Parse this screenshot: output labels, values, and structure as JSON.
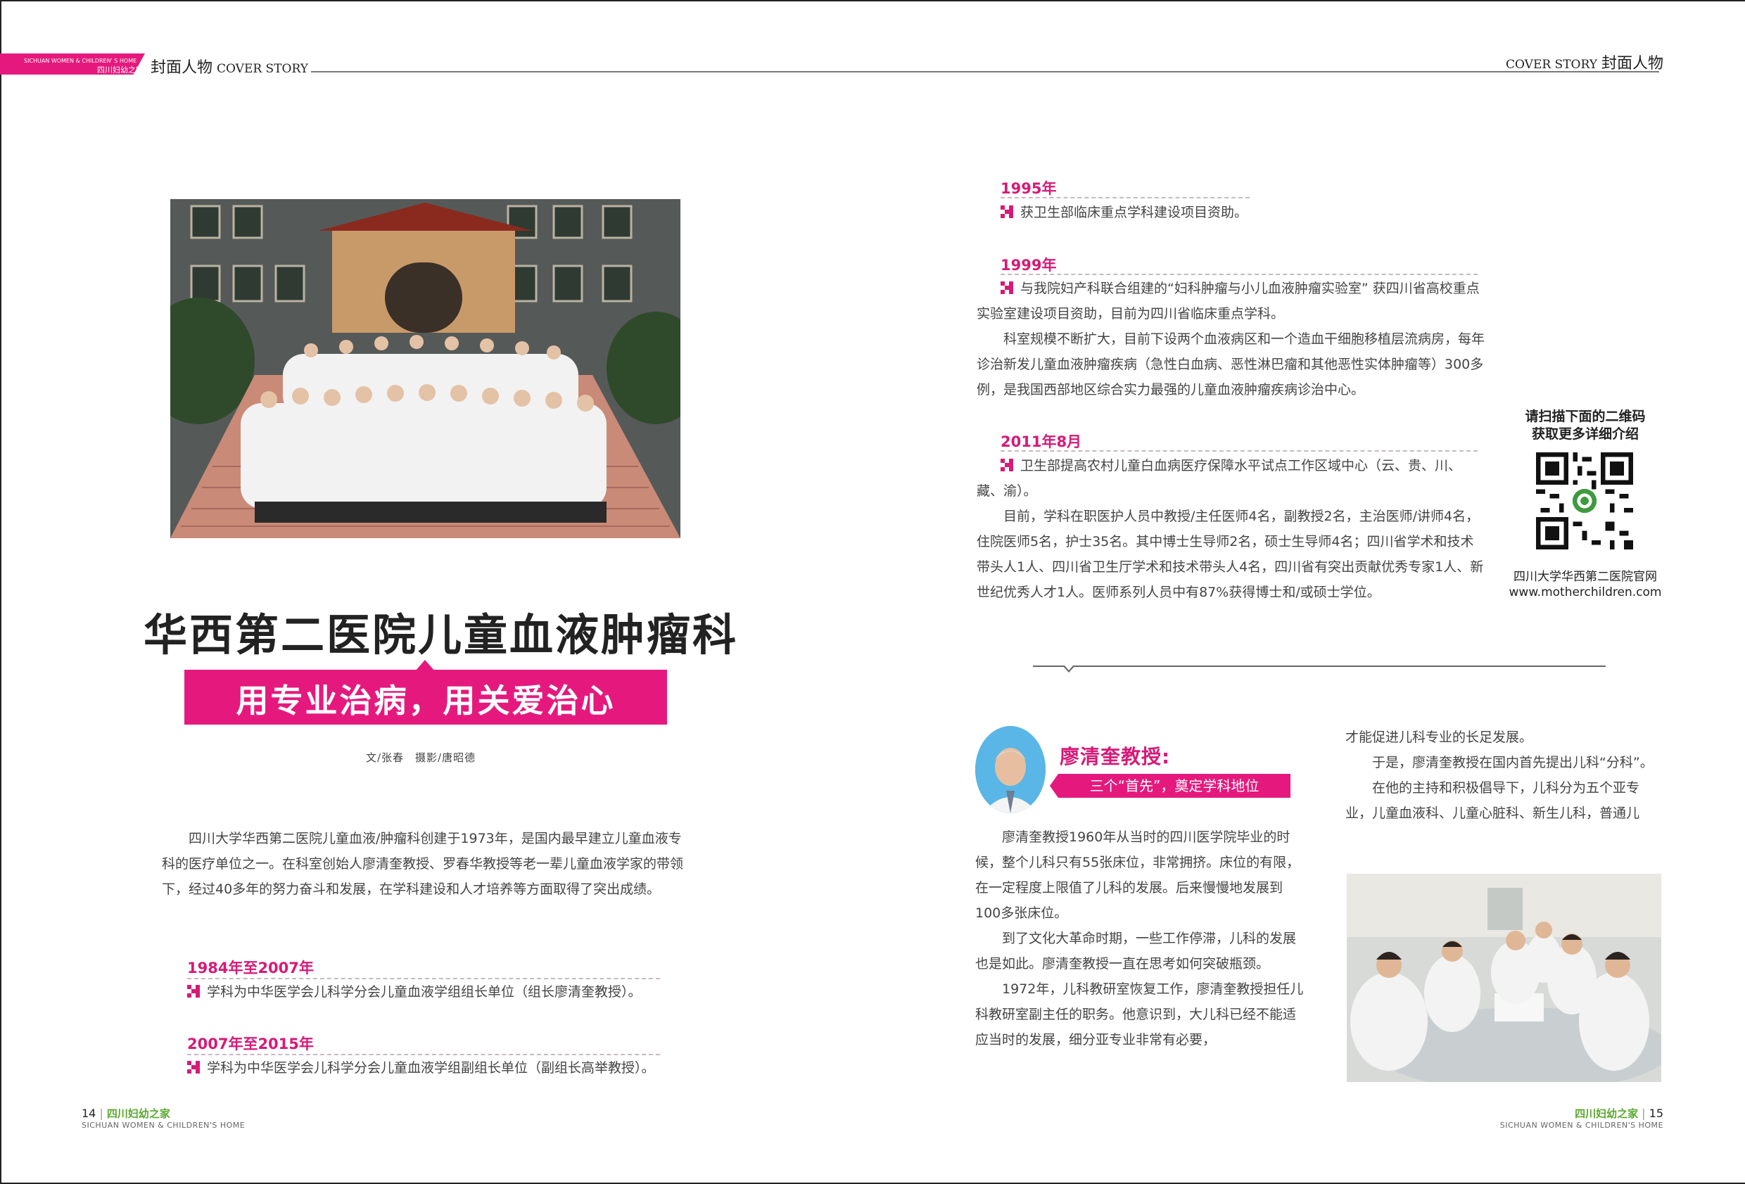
{
  "header": {
    "tag_en": "SICHUAN WOMEN & CHILDREN' S HOME",
    "tag_cn": "四川妇幼之家",
    "left_title_cn": "封面人物",
    "left_title_en": "COVER STORY",
    "right_title_en": "COVER STORY",
    "right_title_cn": "封面人物"
  },
  "article": {
    "title": "华西第二医院儿童血液肿瘤科",
    "subtitle": "用专业治病，用关爱治心",
    "credits": "文/张春　摄影/唐昭德",
    "intro": "四川大学华西第二医院儿童血液/肿瘤科创建于1973年，是国内最早建立儿童血液专科的医疗单位之一。在科室创始人廖清奎教授、罗春华教授等老一辈儿童血液学家的带领下，经过40多年的努力奋斗和发展，在学科建设和人才培养等方面取得了突出成绩。"
  },
  "timeline": [
    {
      "year": "1984年至2007年",
      "text": "学科为中华医学会儿科学分会儿童血液学组组长单位（组长廖清奎教授）。"
    },
    {
      "year": "2007年至2015年",
      "text": "学科为中华医学会儿科学分会儿童血液学组副组长单位（副组长高举教授）。"
    },
    {
      "year": "1995年",
      "text": "获卫生部临床重点学科建设项目资助。"
    },
    {
      "year": "1999年",
      "text": "与我院妇产科联合组建的“妇科肿瘤与小儿血液肿瘤实验室” 获四川省高校重点实验室建设项目资助，目前为四川省临床重点学科。",
      "extra": "科室规模不断扩大，目前下设两个血液病区和一个造血干细胞移植层流病房，每年诊治新发儿童血液肿瘤疾病（急性白血病、恶性淋巴瘤和其他恶性实体肿瘤等）300多例，是我国西部地区综合实力最强的儿童血液肿瘤疾病诊治中心。"
    },
    {
      "year": "2011年8月",
      "text": "卫生部提高农村儿童白血病医疗保障水平试点工作区域中心（云、贵、川、藏、渝）。",
      "extra": "目前，学科在职医护人员中教授/主任医师4名，副教授2名，主治医师/讲师4名，住院医师5名，护士35名。其中博士生导师2名，硕士生导师4名；四川省学术和技术带头人1人、四川省卫生厅学术和技术带头人4名，四川省有突出贡献优秀专家1人、新世纪优秀人才1人。医师系列人员中有87%获得博士和/或硕士学位。"
    }
  ],
  "qr": {
    "title_line1": "请扫描下面的二维码",
    "title_line2": "获取更多详细介绍",
    "caption_line1": "四川大学华西第二医院官网",
    "caption_line2": "www.motherchildren.com"
  },
  "profile": {
    "name": "廖清奎教授:",
    "tag": "三个“首先”，奠定学科地位",
    "col3": [
      "廖清奎教授1960年从当时的四川医学院毕业的时候，整个儿科只有55张床位，非常拥挤。床位的有限，在一定程度上限值了儿科的发展。后来慢慢地发展到100多张床位。",
      "到了文化大革命时期，一些工作停滞，儿科的发展也是如此。廖清奎教授一直在思考如何突破瓶颈。",
      "1972年，儿科教研室恢复工作，廖清奎教授担任儿科教研室副主任的职务。他意识到，大儿科已经不能适应当时的发展，细分亚专业非常有必要，"
    ],
    "col4_cont": "才能促进儿科专业的长足发展。",
    "col4": [
      "于是，廖清奎教授在国内首先提出儿科“分科”。",
      "在他的主持和积极倡导下，儿科分为五个亚专业，儿童血液科、儿童心脏科、新生儿科，普通儿"
    ]
  },
  "footer": {
    "left_page": "14",
    "left_brand": "四川妇幼之家",
    "left_en": "SICHUAN WOMEN & CHILDREN'S HOME",
    "right_brand": "四川妇幼之家",
    "right_page": "15",
    "right_en": "SICHUAN WOMEN & CHILDREN'S HOME"
  },
  "colors": {
    "accent": "#e5197d",
    "year": "#d61a78",
    "brand_green": "#5aa82e"
  }
}
